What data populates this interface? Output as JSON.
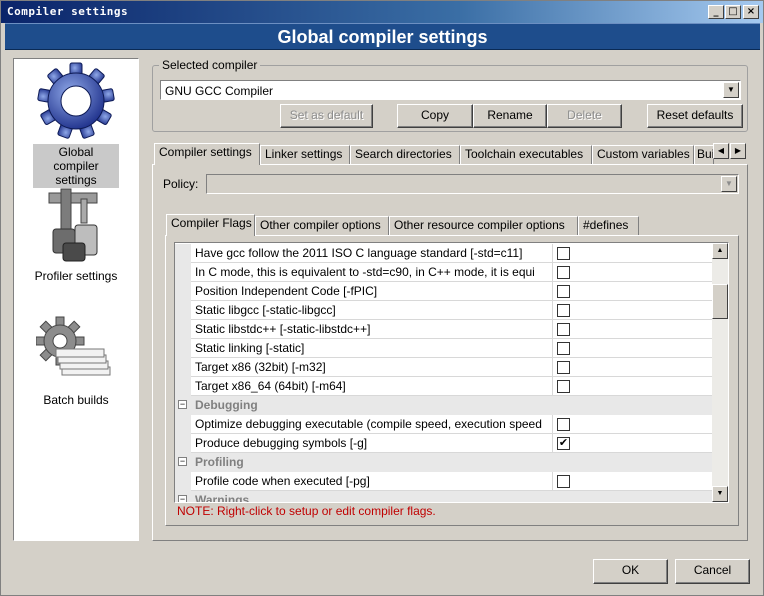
{
  "window": {
    "title": "Compiler settings",
    "controls": {
      "minimize": "_",
      "maximize": "□",
      "close": "×"
    }
  },
  "header": {
    "title": "Global compiler settings"
  },
  "sidebar": {
    "items": [
      {
        "label": "Global compiler settings",
        "icon": "gear-icon",
        "selected": true
      },
      {
        "label": "Profiler settings",
        "icon": "profiler-icon",
        "selected": false
      },
      {
        "label": "Batch builds",
        "icon": "batch-builds-icon",
        "selected": false
      }
    ]
  },
  "compiler_group": {
    "title": "Selected compiler",
    "selected_value": "GNU GCC Compiler",
    "buttons": {
      "set_default": "Set as default",
      "copy": "Copy",
      "rename": "Rename",
      "delete": "Delete",
      "reset": "Reset defaults"
    }
  },
  "main_tabs": [
    "Compiler settings",
    "Linker settings",
    "Search directories",
    "Toolchain executables",
    "Custom variables",
    "Build"
  ],
  "main_tabs_visible": [
    "Compiler settings",
    "Linker settings",
    "Search directories",
    "Toolchain executables",
    "Custom variables",
    "Bui"
  ],
  "policy": {
    "label": "Policy:",
    "value": ""
  },
  "sub_tabs": [
    "Compiler Flags",
    "Other compiler options",
    "Other resource compiler options",
    "#defines"
  ],
  "flags": {
    "rows": [
      {
        "type": "flag",
        "name": "Have gcc follow the 2011 ISO C language standard  [-std=c11]",
        "checked": false
      },
      {
        "type": "flag",
        "name": "In C mode, this is equivalent to -std=c90, in C++ mode, it is equi",
        "checked": false
      },
      {
        "type": "flag",
        "name": "Position Independent Code  [-fPIC]",
        "checked": false
      },
      {
        "type": "flag",
        "name": "Static libgcc  [-static-libgcc]",
        "checked": false
      },
      {
        "type": "flag",
        "name": "Static libstdc++  [-static-libstdc++]",
        "checked": false
      },
      {
        "type": "flag",
        "name": "Static linking  [-static]",
        "checked": false
      },
      {
        "type": "flag",
        "name": "Target x86 (32bit)  [-m32]",
        "checked": false
      },
      {
        "type": "flag",
        "name": "Target x86_64 (64bit)  [-m64]",
        "checked": false
      },
      {
        "type": "category",
        "name": "Debugging",
        "expander": "⊟"
      },
      {
        "type": "flag",
        "name": "Optimize debugging executable (compile speed, execution speed",
        "checked": false
      },
      {
        "type": "flag",
        "name": "Produce debugging symbols  [-g]",
        "checked": true
      },
      {
        "type": "category",
        "name": "Profiling",
        "expander": "⊟"
      },
      {
        "type": "flag",
        "name": "Profile code when executed  [-pg]",
        "checked": false
      },
      {
        "type": "category",
        "name": "Warnings",
        "expander": "⊟"
      }
    ],
    "check_mark": "✔"
  },
  "note": "NOTE: Right-click to setup or edit compiler flags.",
  "footer": {
    "ok": "OK",
    "cancel": "Cancel"
  },
  "colors": {
    "banner": "#1e4d8c",
    "note": "#c00000",
    "face": "#d4d0c8"
  }
}
